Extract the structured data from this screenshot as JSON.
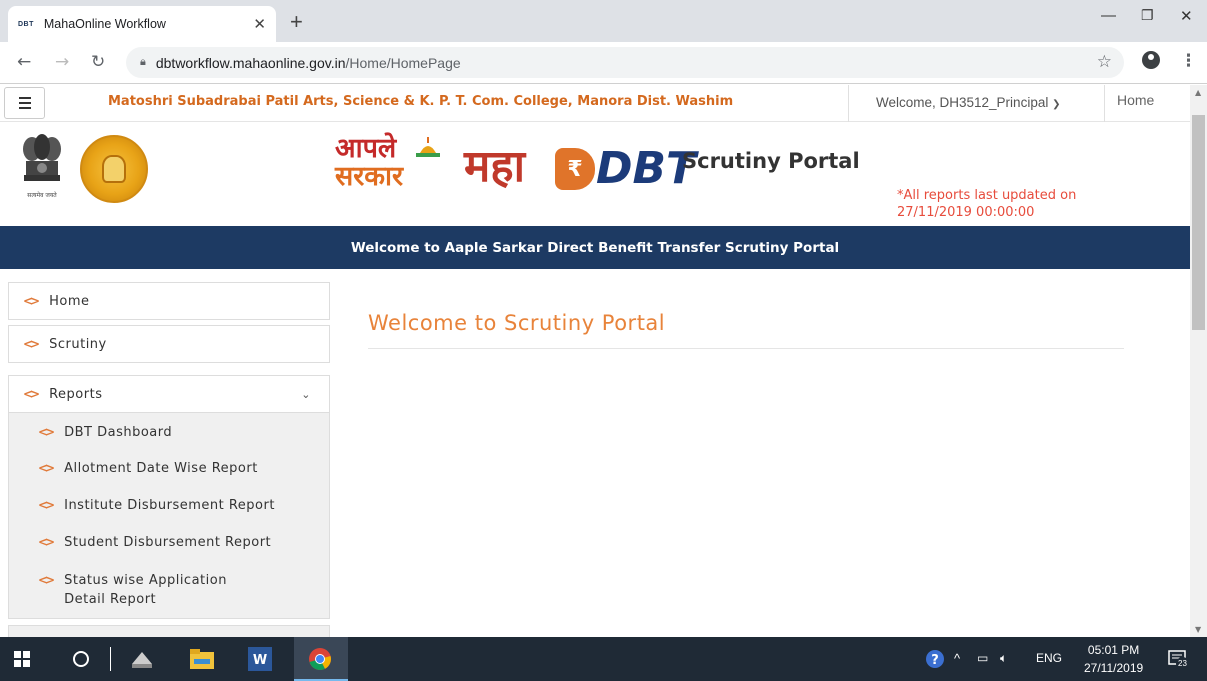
{
  "browser": {
    "tab_title": "MahaOnline Workflow",
    "tab_favicon": "DBT",
    "url_host": "dbtworkflow.mahaonline.gov.in",
    "url_path": "/Home/HomePage"
  },
  "topnav": {
    "college": "Matoshri Subadrabai Patil Arts, Science & K. P. T. Com. College, Manora Dist. Washim",
    "welcome": "Welcome, DH3512_Principal",
    "home": "Home"
  },
  "header": {
    "aaple_line1": "आपले",
    "aaple_line2": "सरकार",
    "maha": "महा",
    "rupee": "₹",
    "dbt": "DBT",
    "portal_title": "Scrutiny Portal",
    "updated_line1": "*All reports last updated on",
    "updated_line2": "27/11/2019 00:00:00",
    "emblem_motto": "सत्यमेव जयते"
  },
  "banner": {
    "text": "Welcome to Aaple Sarkar Direct Benefit Transfer Scrutiny Portal"
  },
  "sidebar": {
    "items": [
      {
        "label": "Home"
      },
      {
        "label": "Scrutiny"
      },
      {
        "label": "Reports"
      }
    ],
    "reports_sub": [
      {
        "label": "DBT Dashboard"
      },
      {
        "label": "Allotment Date Wise Report"
      },
      {
        "label": "Institute Disbursement Report"
      },
      {
        "label": "Student Disbursement Report"
      },
      {
        "label": "Status wise Application Detail Report"
      }
    ]
  },
  "main": {
    "title": "Welcome to Scrutiny Portal"
  },
  "taskbar": {
    "lang": "ENG",
    "time": "05:01 PM",
    "date": "27/11/2019",
    "notifications": "23"
  },
  "colors": {
    "banner": "#1d3a63",
    "accent_orange": "#e8833a",
    "college_orange": "#d4691e",
    "alert_red": "#e74c3c"
  }
}
